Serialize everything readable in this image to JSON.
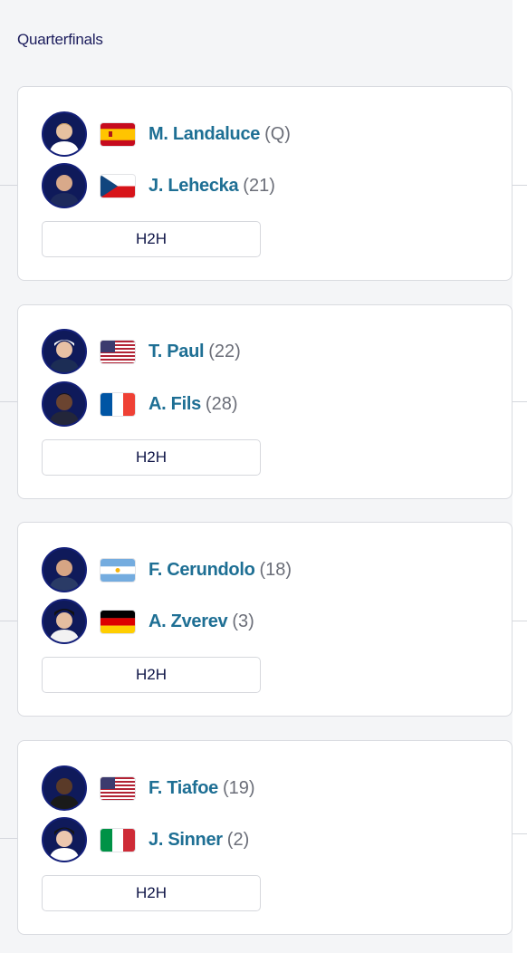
{
  "round": {
    "title": "Quarterfinals"
  },
  "matches": [
    {
      "h2h_label": "H2H",
      "players": [
        {
          "name": "M. Landaluce",
          "seed": "(Q)",
          "flag": "spain-flag",
          "avatar": "player-photo"
        },
        {
          "name": "J. Lehecka",
          "seed": "(21)",
          "flag": "czech-flag",
          "avatar": "player-photo"
        }
      ]
    },
    {
      "h2h_label": "H2H",
      "players": [
        {
          "name": "T. Paul",
          "seed": "(22)",
          "flag": "usa-flag",
          "avatar": "player-photo"
        },
        {
          "name": "A. Fils",
          "seed": "(28)",
          "flag": "france-flag",
          "avatar": "player-photo"
        }
      ]
    },
    {
      "h2h_label": "H2H",
      "players": [
        {
          "name": "F. Cerundolo",
          "seed": "(18)",
          "flag": "argentina-flag",
          "avatar": "player-photo"
        },
        {
          "name": "A. Zverev",
          "seed": "(3)",
          "flag": "germany-flag",
          "avatar": "player-photo"
        }
      ]
    },
    {
      "h2h_label": "H2H",
      "players": [
        {
          "name": "F. Tiafoe",
          "seed": "(19)",
          "flag": "usa-flag",
          "avatar": "player-photo"
        },
        {
          "name": "J. Sinner",
          "seed": "(2)",
          "flag": "italy-flag",
          "avatar": "player-photo"
        }
      ]
    }
  ],
  "colors": {
    "player_name": "#1e6f94",
    "seed": "#6b6e78",
    "title": "#1b1c5c",
    "avatar_ring": "#14207a"
  }
}
